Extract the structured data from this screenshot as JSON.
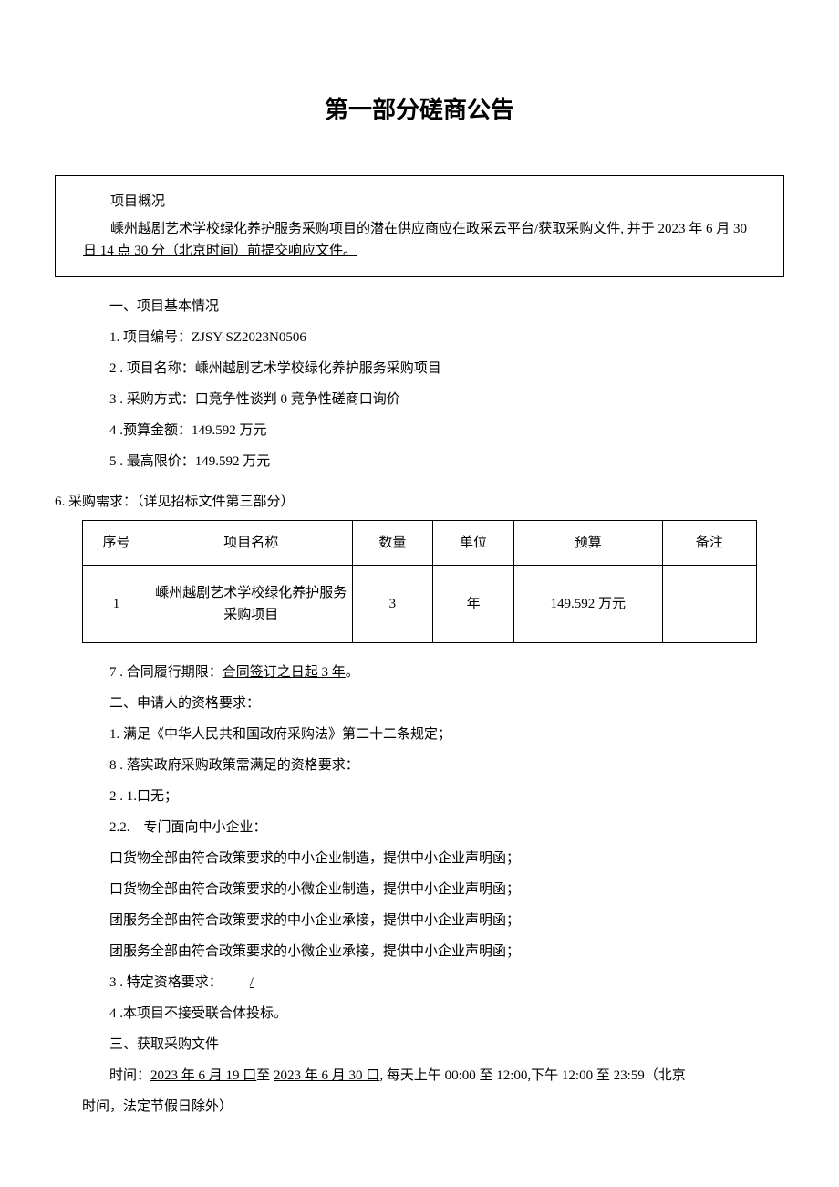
{
  "title": "第一部分磋商公告",
  "overview": {
    "heading": "项目概况",
    "sentence_pre": "",
    "proj_name_ul": "嵊州越剧艺术学校绿化养护服务采购项目",
    "mid1": "的潜在供应商应在",
    "platform_ul": "政采云平台/",
    "mid2": "获取采购文件, 并于 ",
    "deadline_ul": "2023 年 6 月 30 日 14 点 30 分（北京时间）前提交响应文件。"
  },
  "s1_heading": "一、项目基本情况",
  "s1_1": "1. 项目编号：ZJSY-SZ2023N0506",
  "s1_2": "2 . 项目名称：嵊州越剧艺术学校绿化养护服务采购项目",
  "s1_3": "3 . 采购方式：口竞争性谈判 0 竞争性磋商口询价",
  "s1_4": "4 .预算金额：149.592 万元",
  "s1_5": "5 . 最高限价：149.592 万元",
  "s1_6_caption": "6. 采购需求：（详见招标文件第三部分）",
  "table": {
    "headers": {
      "c1": "序号",
      "c2": "项目名称",
      "c3": "数量",
      "c4": "单位",
      "c5": "预算",
      "c6": "备注"
    },
    "row": {
      "c1": "1",
      "c2": "嵊州越剧艺术学校绿化养护服务采购项目",
      "c3": "3",
      "c4": "年",
      "c5": "149.592 万元",
      "c6": ""
    }
  },
  "s1_7_pre": "7 . 合同履行期限：",
  "s1_7_ul": "合同签订之日起 3 年",
  "s1_7_post": "。",
  "s2_heading": "二、申请人的资格要求：",
  "s2_1": "1. 满足《中华人民共和国政府采购法》第二十二条规定；",
  "s2_8": "8 . 落实政府采购政策需满足的资格要求：",
  "s2_2_1": "2 . 1.口无；",
  "s2_2_2": "2.2. 专门面向中小企业：",
  "s2_lines": {
    "a": "口货物全部由符合政策要求的中小企业制造，提供中小企业声明函；",
    "b": "口货物全部由符合政策要求的小微企业制造，提供中小企业声明函；",
    "c": "团服务全部由符合政策要求的中小企业承接，提供中小企业声明函；",
    "d": "团服务全部由符合政策要求的小微企业承接，提供中小企业声明函；"
  },
  "s2_3_pre": "3 . 特定资格要求：  ",
  "s2_3_ul": "/",
  "s2_4": "4 .本项目不接受联合体投标。",
  "s3_heading": "三、获取采购文件",
  "s3_time_pre": "时间：",
  "s3_d1": "2023 年 6 月 19 口",
  "s3_mid": "至 ",
  "s3_d2": "2023 年 6 月 30 口",
  "s3_time_post": ", 每天上午 00:00 至 12:00,下午 12:00 至 23:59（北京",
  "s3_time_cont": "时间，法定节假日除外）"
}
